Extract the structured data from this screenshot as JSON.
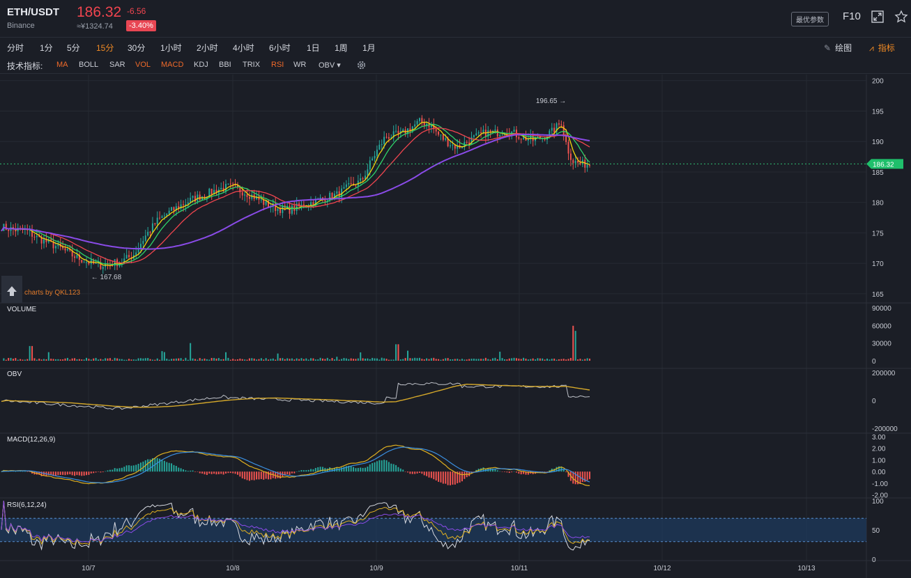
{
  "header": {
    "symbol": "ETH/USDT",
    "exchange": "Binance",
    "price": "186.32",
    "change": "-6.56",
    "cny": "≈¥1324.74",
    "change_pct": "-3.40%",
    "best_params": "最优参数",
    "f10": "F10",
    "icons": [
      "expand-icon",
      "star-icon"
    ]
  },
  "periods": [
    {
      "label": "分时",
      "active": false
    },
    {
      "label": "1分",
      "active": false
    },
    {
      "label": "5分",
      "active": false
    },
    {
      "label": "15分",
      "active": true
    },
    {
      "label": "30分",
      "active": false
    },
    {
      "label": "1小时",
      "active": false
    },
    {
      "label": "2小时",
      "active": false
    },
    {
      "label": "4小时",
      "active": false
    },
    {
      "label": "6小时",
      "active": false
    },
    {
      "label": "1日",
      "active": false
    },
    {
      "label": "1周",
      "active": false
    },
    {
      "label": "1月",
      "active": false
    }
  ],
  "toolbar": {
    "draw_label": "绘图",
    "indicator_label": "指标"
  },
  "indicators": {
    "label": "技术指标:",
    "items": [
      {
        "label": "MA",
        "on": true
      },
      {
        "label": "BOLL",
        "on": false
      },
      {
        "label": "SAR",
        "on": false
      },
      {
        "label": "VOL",
        "on": true
      },
      {
        "label": "MACD",
        "on": true
      },
      {
        "label": "KDJ",
        "on": false
      },
      {
        "label": "BBI",
        "on": false
      },
      {
        "label": "TRIX",
        "on": false
      },
      {
        "label": "RSI",
        "on": true
      },
      {
        "label": "WR",
        "on": false
      },
      {
        "label": "OBV",
        "on": false
      }
    ]
  },
  "colors": {
    "up": "#26a69a",
    "down": "#ef5350",
    "ma_yellow": "#f5d50b",
    "ma_green": "#2fd36a",
    "ma_red": "#f0454f",
    "ma_purple": "#8a4be8",
    "accent": "#f08a24"
  },
  "chart_data": {
    "type": "candlestick",
    "watermark": "charts by QKL123",
    "x_ticks": [
      "10/7",
      "10/8",
      "10/9",
      "10/11",
      "10/12",
      "10/13"
    ],
    "price": {
      "ylim": [
        163.5,
        201
      ],
      "y_ticks": [
        200,
        195,
        190,
        185,
        180,
        175,
        170,
        165
      ],
      "last_price": "186.32",
      "high_marker": "196.65",
      "low_marker": "167.68",
      "close_path": [
        [
          0,
          176
        ],
        [
          0.03,
          175.5
        ],
        [
          0.06,
          175.4
        ],
        [
          0.09,
          174.2
        ],
        [
          0.12,
          173.3
        ],
        [
          0.15,
          172.4
        ],
        [
          0.18,
          171.2
        ],
        [
          0.21,
          170.4
        ],
        [
          0.24,
          169.6
        ],
        [
          0.27,
          169.9
        ],
        [
          0.3,
          170.3
        ],
        [
          0.33,
          171.4
        ],
        [
          0.36,
          174.5
        ],
        [
          0.39,
          177.0
        ],
        [
          0.42,
          178.4
        ],
        [
          0.45,
          179.6
        ],
        [
          0.48,
          180.6
        ],
        [
          0.51,
          181.3
        ],
        [
          0.54,
          182.1
        ],
        [
          0.57,
          182.6
        ],
        [
          0.6,
          181.9
        ],
        [
          0.63,
          181.0
        ],
        [
          0.66,
          179.8
        ],
        [
          0.69,
          179.0
        ],
        [
          0.72,
          178.8
        ],
        [
          0.75,
          179.4
        ],
        [
          0.78,
          180.1
        ],
        [
          0.81,
          180.8
        ],
        [
          0.84,
          181.3
        ],
        [
          0.87,
          182.6
        ],
        [
          0.9,
          183.5
        ],
        [
          0.93,
          187.5
        ],
        [
          0.96,
          190.8
        ],
        [
          1.0,
          191.2
        ]
      ],
      "session2_path": [
        [
          0,
          191.2
        ],
        [
          0.05,
          192.3
        ],
        [
          0.1,
          193.3
        ],
        [
          0.15,
          192.8
        ],
        [
          0.2,
          191.0
        ],
        [
          0.25,
          189.8
        ],
        [
          0.3,
          189.0
        ],
        [
          0.35,
          190.0
        ],
        [
          0.4,
          190.8
        ],
        [
          0.45,
          191.5
        ],
        [
          0.5,
          191.4
        ],
        [
          0.55,
          191.8
        ],
        [
          0.6,
          191.3
        ],
        [
          0.65,
          190.6
        ],
        [
          0.7,
          190.2
        ],
        [
          0.75,
          190.7
        ],
        [
          0.8,
          191.6
        ],
        [
          0.85,
          193.2
        ],
        [
          0.88,
          189.0
        ],
        [
          0.91,
          186.8
        ],
        [
          0.95,
          186.3
        ],
        [
          1.0,
          186.3
        ]
      ]
    },
    "volume": {
      "ylim": [
        0,
        90000
      ],
      "y_ticks": [
        90000,
        60000,
        30000,
        0
      ]
    },
    "obv": {
      "ylim": [
        -220000,
        230000
      ],
      "y_ticks": [
        200000,
        0,
        -200000
      ]
    },
    "macd": {
      "title": "MACD(12,26,9)",
      "ylim": [
        -2.2,
        3.3
      ],
      "y_ticks": [
        "3.00",
        "2.00",
        "1.00",
        "0.00",
        "-1.00",
        "-2.00"
      ]
    },
    "rsi": {
      "title": "RSI(6,12,24)",
      "ylim": [
        0,
        100
      ],
      "y_ticks": [
        100,
        50,
        0
      ],
      "band": [
        30,
        70
      ]
    },
    "pane_titles": {
      "volume": "VOLUME",
      "obv": "OBV"
    }
  }
}
